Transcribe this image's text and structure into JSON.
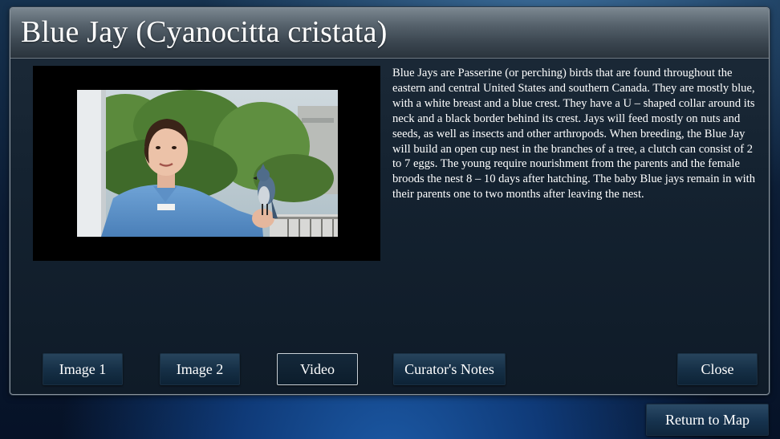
{
  "window": {
    "title": "Blue Jay (Cyanocitta cristata)"
  },
  "media": {
    "type": "video",
    "subject": "video-still-presenter-with-blue-jay"
  },
  "description": "Blue Jays are Passerine (or perching) birds that are found throughout the eastern and central United States and southern Canada. They are mostly blue, with a white breast and a blue crest. They have a U – shaped collar around its neck and a black border behind its crest. Jays will feed mostly on nuts and seeds, as well as insects and other arthropods. When breeding, the Blue Jay will build an open cup nest in the branches of a tree, a clutch can consist of 2 to 7 eggs. The young require nourishment from the parents and the female broods the nest 8 – 10 days after hatching. The baby Blue jays remain in with their parents one to two months after leaving the nest.",
  "buttons": {
    "image1": "Image 1",
    "image2": "Image 2",
    "video": "Video",
    "curators_notes": "Curator's Notes",
    "close": "Close",
    "return_to_map": "Return to Map"
  },
  "active_tab": "Video",
  "colors": {
    "panel_bg": "#142230",
    "title_bar": "#55616b",
    "button": "#163047",
    "active_border": "#c9d0d6",
    "text": "#ffffff"
  }
}
